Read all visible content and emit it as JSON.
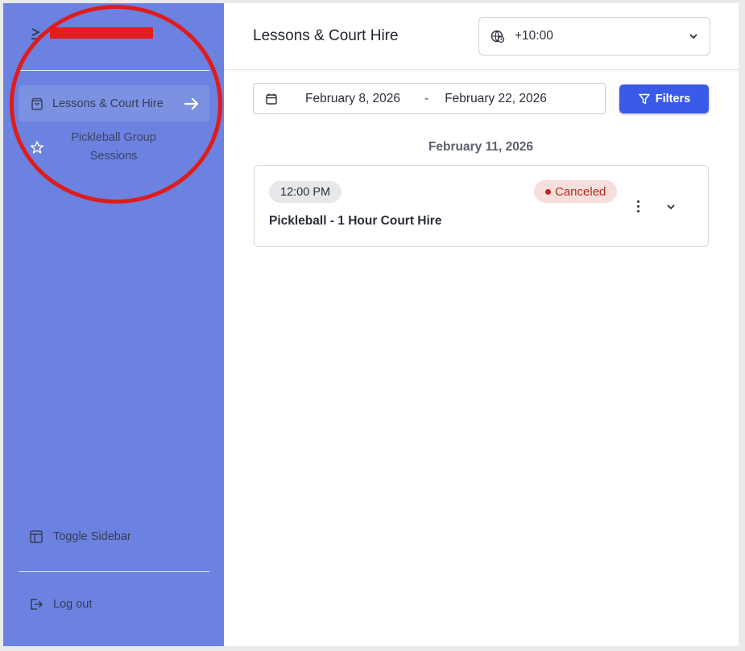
{
  "sidebar": {
    "brand_name": "redacted",
    "items": [
      {
        "label": "Lessons & Court Hire",
        "icon": "shopping-bag-icon",
        "active": true
      },
      {
        "label": "Pickleball Group Sessions",
        "icon": "star-icon",
        "active": false
      }
    ],
    "toggle_label": "Toggle Sidebar",
    "logout_label": "Log out"
  },
  "header": {
    "title": "Lessons & Court Hire",
    "timezone": "+10:00"
  },
  "filters": {
    "start_date": "February 8, 2026",
    "separator": "-",
    "end_date": "February 22, 2026",
    "button_label": "Filters"
  },
  "schedule": {
    "date_heading": "February 11, 2026",
    "bookings": [
      {
        "time": "12:00 PM",
        "title": "Pickleball - 1 Hour Court Hire",
        "status": "Canceled"
      }
    ]
  },
  "colors": {
    "sidebar_bg": "#6b82e0",
    "primary_button": "#3a5ae8",
    "status_canceled_bg": "#f6dedc",
    "status_canceled_text": "#b42b1f",
    "annotation": "#e01b1b"
  }
}
